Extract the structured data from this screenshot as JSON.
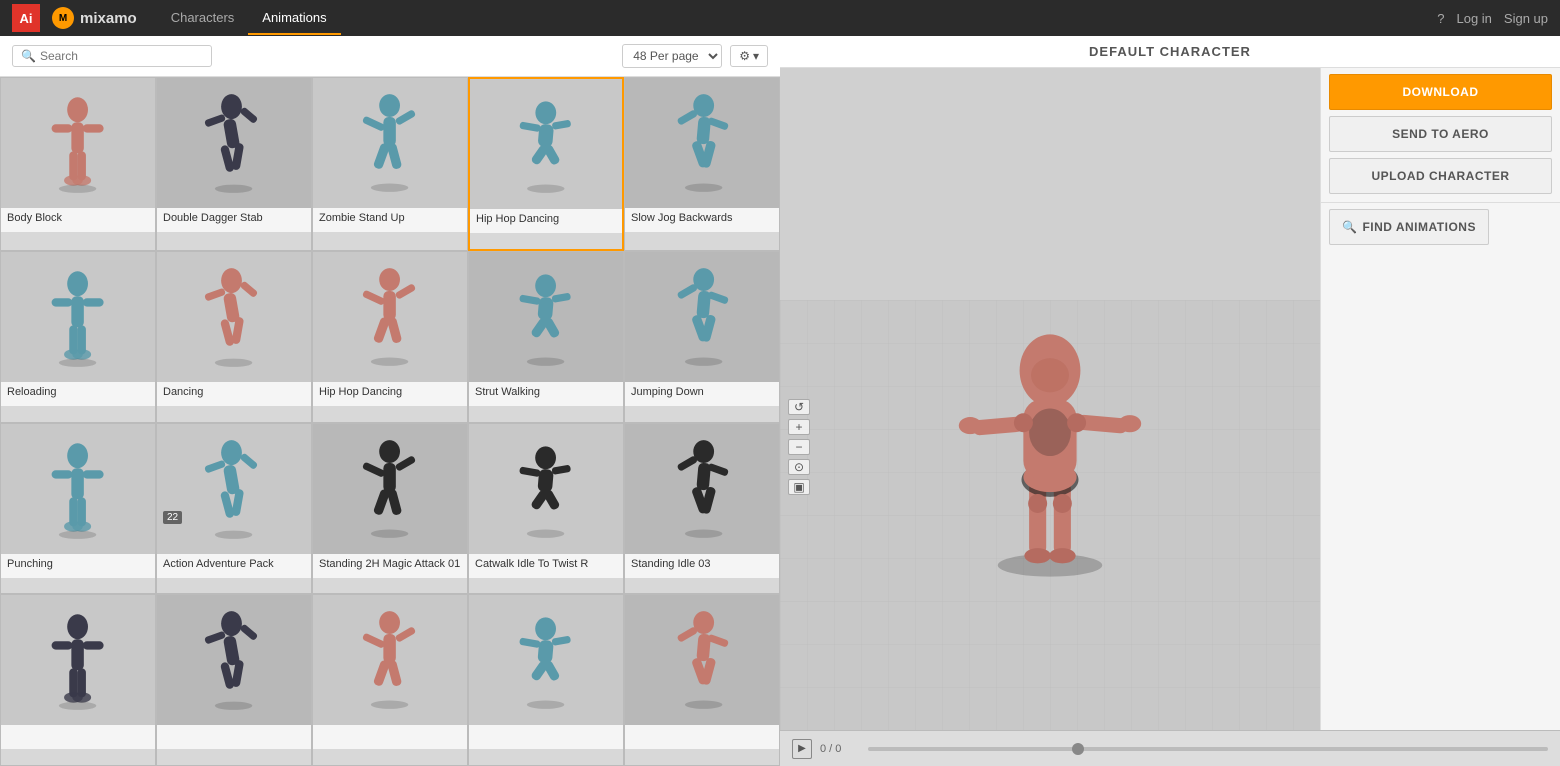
{
  "app": {
    "adobe_label": "Ai",
    "mixamo_icon_label": "M",
    "mixamo_text": "mixamo",
    "nav_characters": "Characters",
    "nav_animations": "Animations",
    "help_label": "?",
    "login_label": "Log in",
    "signup_label": "Sign up"
  },
  "toolbar": {
    "search_placeholder": "Search",
    "per_page_label": "48 Per page",
    "settings_label": "⚙"
  },
  "animations": [
    {
      "id": 1,
      "name": "Body Block",
      "color": "salmon",
      "bg": "light"
    },
    {
      "id": 2,
      "name": "Double Dagger Stab",
      "color": "dark",
      "bg": "mid"
    },
    {
      "id": 3,
      "name": "Zombie Stand Up",
      "color": "teal",
      "bg": "light"
    },
    {
      "id": 4,
      "name": "Hip Hop Dancing",
      "color": "teal",
      "bg": "light",
      "selected": true
    },
    {
      "id": 5,
      "name": "Slow Jog Backwards",
      "color": "teal",
      "bg": "mid"
    },
    {
      "id": 6,
      "name": "Reloading",
      "color": "teal",
      "bg": "light"
    },
    {
      "id": 7,
      "name": "Dancing",
      "color": "salmon",
      "bg": "light"
    },
    {
      "id": 8,
      "name": "Hip Hop Dancing",
      "color": "salmon",
      "bg": "light"
    },
    {
      "id": 9,
      "name": "Strut Walking",
      "color": "teal",
      "bg": "mid"
    },
    {
      "id": 10,
      "name": "Jumping Down",
      "color": "teal",
      "bg": "mid"
    },
    {
      "id": 11,
      "name": "Punching",
      "color": "teal",
      "bg": "light"
    },
    {
      "id": 12,
      "name": "Action Adventure Pack",
      "color": "teal",
      "bg": "light",
      "badge": "22"
    },
    {
      "id": 13,
      "name": "Standing 2H Magic Attack 01",
      "color": "black",
      "bg": "mid"
    },
    {
      "id": 14,
      "name": "Catwalk Idle To Twist R",
      "color": "black",
      "bg": "light"
    },
    {
      "id": 15,
      "name": "Standing Idle 03",
      "color": "black",
      "bg": "mid"
    },
    {
      "id": 16,
      "name": "",
      "color": "dark",
      "bg": "light"
    },
    {
      "id": 17,
      "name": "",
      "color": "dark",
      "bg": "mid"
    },
    {
      "id": 18,
      "name": "",
      "color": "salmon",
      "bg": "light"
    },
    {
      "id": 19,
      "name": "",
      "color": "teal",
      "bg": "light"
    },
    {
      "id": 20,
      "name": "",
      "color": "salmon",
      "bg": "mid"
    }
  ],
  "viewport": {
    "header": "DEFAULT CHARACTER",
    "time_display": "0 / 0"
  },
  "actions": {
    "download": "DOWNLOAD",
    "send_to_aero": "SEND TO AERO",
    "upload_character": "UPLOAD CHARACTER",
    "find_animations": "FIND ANIMATIONS",
    "find_icon": "🔍"
  }
}
